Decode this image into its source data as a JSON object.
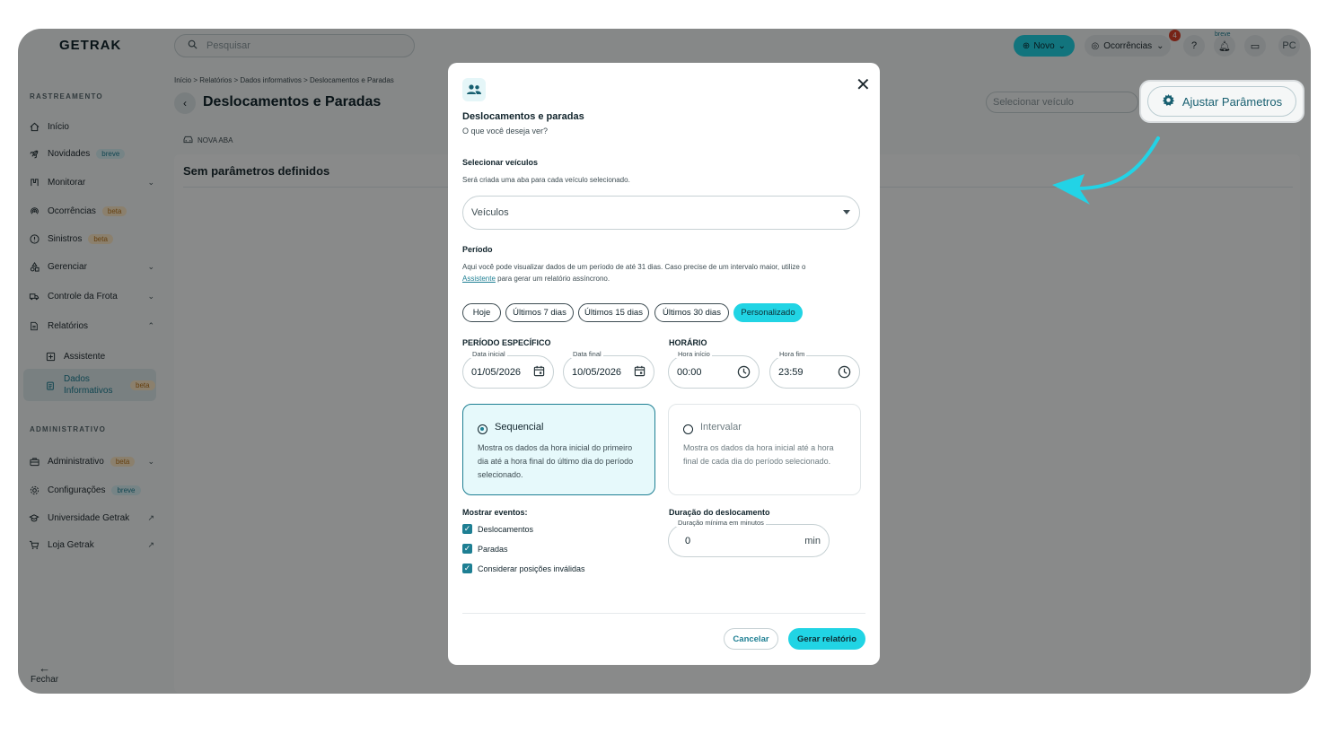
{
  "app": {
    "logo": "GETRAK"
  },
  "sidebar": {
    "section_tracking": "RASTREAMENTO",
    "section_admin": "ADMINISTRATIVO",
    "items": [
      {
        "label": "Início",
        "icon": "home-icon"
      },
      {
        "label": "Novidades",
        "icon": "rocket-icon",
        "badge": "breve"
      },
      {
        "label": "Monitorar",
        "icon": "monitor-icon"
      },
      {
        "label": "Ocorrências",
        "icon": "radar-icon",
        "badge": "beta"
      },
      {
        "label": "Sinistros",
        "icon": "alert-circle-icon",
        "badge": "beta"
      },
      {
        "label": "Gerenciar",
        "icon": "shapes-icon"
      },
      {
        "label": "Controle da Frota",
        "icon": "truck-icon"
      },
      {
        "label": "Relatórios",
        "icon": "document-icon"
      },
      {
        "label": "Assistente",
        "icon": "assistant-icon"
      },
      {
        "label": "Dados Informativos",
        "icon": "clipboard-icon",
        "badge": "beta"
      }
    ],
    "admin_items": [
      {
        "label": "Administrativo",
        "icon": "briefcase-icon",
        "badge": "beta"
      },
      {
        "label": "Configurações",
        "icon": "gear-icon",
        "badge": "breve"
      },
      {
        "label": "Universidade Getrak",
        "icon": "graduation-icon"
      },
      {
        "label": "Loja Getrak",
        "icon": "cart-icon"
      }
    ],
    "close_label": "Fechar"
  },
  "topbar": {
    "search_placeholder": "Pesquisar",
    "novo_label": "Novo",
    "ocorrencias_label": "Ocorrências",
    "notif_count": "4",
    "breve_label": "breve",
    "avatar_initials": "PC"
  },
  "page": {
    "breadcrumb": "Início  >  Relatórios  >  Dados informativos  >  Deslocamentos e Paradas",
    "title": "Deslocamentos e Paradas",
    "tab_label": "NOVA ABA",
    "empty_title": "Sem parâmetros definidos",
    "select_vehicle_placeholder": "Selecionar veículo",
    "adjust_params_label": "Ajustar Parâmetros"
  },
  "modal": {
    "title": "Deslocamentos e paradas",
    "subtitle": "O que você deseja ver?",
    "vehicles_label": "Selecionar veículos",
    "vehicles_help": "Será criada uma aba para cada veículo selecionado.",
    "vehicles_placeholder": "Veículos",
    "period_label": "Período",
    "period_help_1": "Aqui você pode visualizar dados de um período de até 31 dias. Caso precise de um intervalo maior, utilize o",
    "period_help_link": "Assistente",
    "period_help_2": " para gerar um relatório assíncrono.",
    "chips": [
      "Hoje",
      "Últimos 7 dias",
      "Últimos 15 dias",
      "Últimos 30 dias",
      "Personalizado"
    ],
    "selected_chip": "Personalizado",
    "specific_period_label": "PERÍODO ESPECÍFICO",
    "schedule_label": "HORÁRIO",
    "date_start_label": "Data inicial",
    "date_start": "01/05/2026",
    "date_end_label": "Data final",
    "date_end": "10/05/2026",
    "time_start_label": "Hora início",
    "time_start": "00:00",
    "time_end_label": "Hora fim",
    "time_end": "23:59",
    "mode_seq_title": "Sequencial",
    "mode_seq_desc": "Mostra os dados da hora inicial do primeiro dia até a hora final do último dia do período selecionado.",
    "mode_int_title": "Intervalar",
    "mode_int_desc": "Mostra os dados da hora inicial até a hora final de cada dia do período selecionado.",
    "events_label": "Mostrar eventos:",
    "events": [
      "Deslocamentos",
      "Paradas",
      "Considerar posições inválidas"
    ],
    "duration_label": "Duração do deslocamento",
    "duration_field_label": "Duração mínima em minutos",
    "duration_value": "0",
    "duration_unit": "min",
    "cancel_label": "Cancelar",
    "generate_label": "Gerar relatório"
  },
  "colors": {
    "accent": "#21d4e4",
    "primary_dark": "#1e7f93",
    "badge_beta": "#fde9c6",
    "badge_breve": "#d8f0f5"
  }
}
